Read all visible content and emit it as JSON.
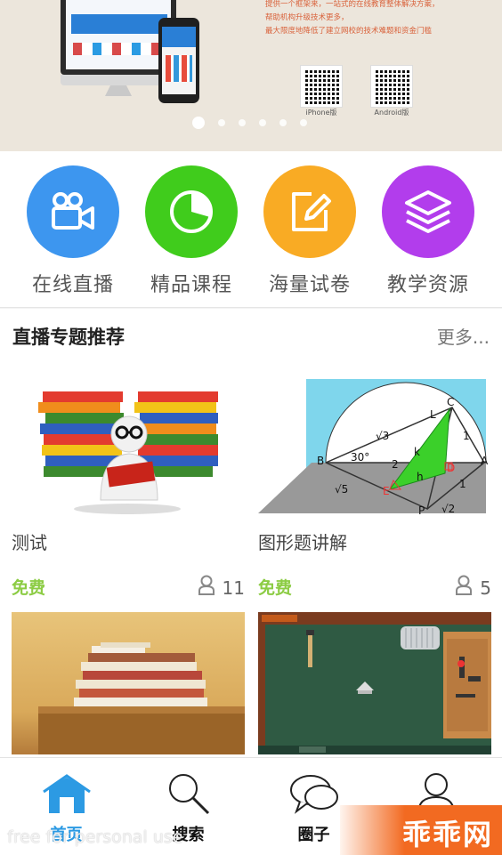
{
  "banner": {
    "text_lines": [
      "提供一个框架来，一站式的在线教育整体解决方案，",
      "帮助机构升级技术更多，",
      "最大限度地降低了建立网校的技术难题和资金门槛"
    ],
    "qr_iphone_label": "iPhone版",
    "qr_android_label": "Android版",
    "carousel": {
      "count": 6,
      "active_index": 0
    }
  },
  "categories": [
    {
      "label": "在线直播",
      "icon": "video-camera-icon",
      "color": "#3d96ef"
    },
    {
      "label": "精品课程",
      "icon": "pie-chart-icon",
      "color": "#40cc1c"
    },
    {
      "label": "海量试卷",
      "icon": "edit-paper-icon",
      "color": "#f9ab24"
    },
    {
      "label": "教学资源",
      "icon": "layers-icon",
      "color": "#b23dec"
    }
  ],
  "section": {
    "title": "直播专题推荐",
    "more": "更多..."
  },
  "cards": [
    {
      "title": "测试",
      "price": "免费",
      "count": "11"
    },
    {
      "title": "图形题讲解",
      "price": "免费",
      "count": "5"
    },
    {
      "title": "",
      "price": "",
      "count": ""
    },
    {
      "title": "",
      "price": "",
      "count": ""
    }
  ],
  "diagram_labels": {
    "c": "C",
    "a": "A",
    "b": "B",
    "l": "L",
    "d": "D",
    "e": "E",
    "p": "P",
    "k": "k",
    "h": "h",
    "sqrt3": "√3",
    "sqrt5": "√5",
    "sqrt2": "√2",
    "angle30": "30°",
    "n2": "2",
    "n1a": "1",
    "n1b": "1"
  },
  "nav": [
    {
      "label": "首页",
      "icon": "home-icon",
      "active": true
    },
    {
      "label": "搜索",
      "icon": "search-icon",
      "active": false
    },
    {
      "label": "圈子",
      "icon": "chat-bubbles-icon",
      "active": false
    },
    {
      "label": "",
      "icon": "user-icon",
      "active": false
    }
  ],
  "watermark": "free for personal use",
  "corner_logo": "乖乖网",
  "colors": {
    "accent": "#2c9ae3",
    "free": "#8ccc44",
    "banner_text": "#d9623b"
  }
}
